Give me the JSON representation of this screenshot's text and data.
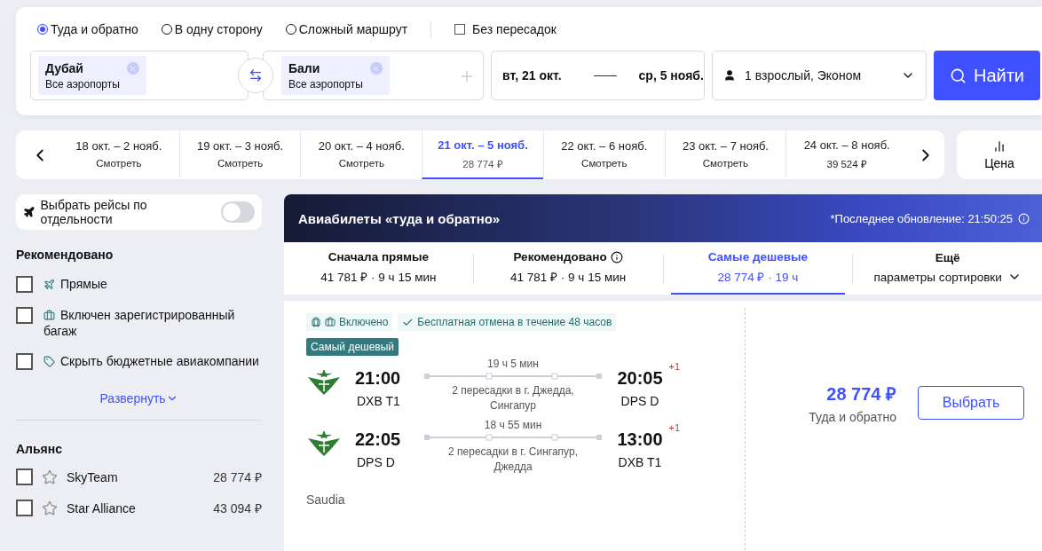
{
  "search": {
    "trip_types": [
      {
        "label": "Туда и обратно",
        "selected": true
      },
      {
        "label": "В одну сторону",
        "selected": false
      },
      {
        "label": "Сложный маршрут",
        "selected": false
      }
    ],
    "direct_only": {
      "label": "Без пересадок",
      "checked": false
    },
    "from": {
      "city": "Дубай",
      "airports": "Все аэропорты"
    },
    "to": {
      "city": "Бали",
      "airports": "Все аэропорты"
    },
    "depart_date": "вт, 21 окт.",
    "return_date": "ср, 5 нояб.",
    "passengers": "1 взрослый, Эконом",
    "button": "Найти"
  },
  "date_strip": [
    {
      "range": "18 окт. – 2 нояб.",
      "sub": "Смотреть",
      "selected": false
    },
    {
      "range": "19 окт. – 3 нояб.",
      "sub": "Смотреть",
      "selected": false
    },
    {
      "range": "20 окт. – 4 нояб.",
      "sub": "Смотреть",
      "selected": false
    },
    {
      "range": "21 окт. – 5 нояб.",
      "sub": "28 774 ₽",
      "selected": true
    },
    {
      "range": "22 окт. – 6 нояб.",
      "sub": "Смотреть",
      "selected": false
    },
    {
      "range": "23 окт. – 7 нояб.",
      "sub": "Смотреть",
      "selected": false
    },
    {
      "range": "24 окт. – 8 нояб.",
      "sub": "39 524 ₽",
      "selected": false
    }
  ],
  "price_chart_button": "Цена",
  "sidebar": {
    "toggle": {
      "label": "Выбрать рейсы по отдельности",
      "on": false
    },
    "recommended_title": "Рекомендовано",
    "filters": [
      {
        "label": "Прямые",
        "checked": false
      },
      {
        "label": "Включен зарегистрированный багаж",
        "checked": false
      },
      {
        "label": "Скрыть бюджетные авиакомпании",
        "checked": false
      }
    ],
    "expand_link": "Развернуть",
    "alliance_title": "Альянс",
    "alliances": [
      {
        "name": "SkyTeam",
        "price": "28 774 ₽",
        "checked": false
      },
      {
        "name": "Star Alliance",
        "price": "43 094 ₽",
        "checked": false
      }
    ]
  },
  "results": {
    "title": "Авиабилеты «туда и обратно»",
    "updated": "*Последнее обновление: 21:50:25",
    "sort_tabs": [
      {
        "kind": "plain",
        "title": "Сначала прямые",
        "sub": "41 781 ₽ · 9 ч 15 мин",
        "selected": false
      },
      {
        "kind": "info",
        "title": "Рекомендовано",
        "sub": "41 781 ₽ · 9 ч 15 мин",
        "selected": false
      },
      {
        "kind": "plain",
        "title": "Самые дешевые",
        "sub": "28 774 ₽ · 19 ч",
        "selected": true
      },
      {
        "kind": "dropdown",
        "title": "Ещё",
        "sub": "параметры сортировки",
        "selected": false
      }
    ],
    "ticket": {
      "baggage": "Включено",
      "cancellation": "Бесплатная отмена в течение 48 часов",
      "tag": "Самый дешевый",
      "legs": [
        {
          "dep_time": "21:00",
          "dep_airport": "DXB T1",
          "duration": "19 ч 5 мин",
          "stops": "2 пересадки в г. Джедда, Сингапур",
          "arr_time": "20:05",
          "arr_airport": "DPS D",
          "day_shift": "+1"
        },
        {
          "dep_time": "22:05",
          "dep_airport": "DPS D",
          "duration": "18 ч 55 мин",
          "stops": "2 пересадки в г. Сингапур, Джедда",
          "arr_time": "13:00",
          "arr_airport": "DXB T1",
          "day_shift": "+1"
        }
      ],
      "airline": "Saudia",
      "price": "28 774 ₽",
      "price_note": "Туда и обратно",
      "button": "Выбрать"
    }
  }
}
